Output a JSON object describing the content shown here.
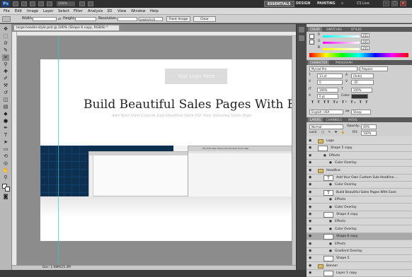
{
  "app": {
    "logo_text": "Ps",
    "zoom": "100%",
    "workspaces": [
      "ESSENTIALS",
      "DESIGN",
      "PAINTING",
      "»"
    ],
    "cs_live": "CS Live"
  },
  "menu": [
    "File",
    "Edit",
    "Image",
    "Layer",
    "Select",
    "Filter",
    "Analysis",
    "3D",
    "View",
    "Window",
    "Help"
  ],
  "options": {
    "width_label": "Width:",
    "height_label": "Height:",
    "resolution_label": "Resolution:",
    "resolution_unit": "pixels/inch",
    "front_image": "Front Image",
    "clear": "Clear"
  },
  "document": {
    "tab_title": "large-header-style.psd @ 100% (Shape 6 copy, RGB/8) *",
    "status": "Doc: 1.98M/25.3M"
  },
  "canvas": {
    "logo": "Your Logo Here",
    "headline": "Build Beautiful Sales Pages With E",
    "subheadline": "Add Your Own Custom Sub-Headline Here For Your Amazing Sales Page",
    "browser_text": "File  Edit  View  History  Bookmarks  Tools  Help"
  },
  "color_panel": {
    "tabs": [
      "COLOR",
      "SWATCHES",
      "STYLES"
    ],
    "r": "255",
    "g": "255",
    "b": "255"
  },
  "character_panel": {
    "tabs": [
      "CHARACTER",
      "PARAGRAPH"
    ],
    "font": "Myriad Pro",
    "style": "Regular",
    "size": "13 pt",
    "leading": "(Auto)",
    "kerning": "0",
    "tracking": "-25",
    "vscale": "100%",
    "hscale": "100%",
    "baseline": "0 pt",
    "color_label": "Color:",
    "language": "English: USA",
    "aa": "Sharp"
  },
  "layers_panel": {
    "tabs": [
      "LAYERS",
      "CHANNELS",
      "PATHS"
    ],
    "blend": "Normal",
    "opacity_label": "Opacity:",
    "opacity": "40%",
    "lock_label": "Lock:",
    "fill_label": "Fill:",
    "fill": "100%",
    "layers": [
      {
        "name": "Logo",
        "kind": "folder",
        "indent": 0
      },
      {
        "name": "Shape 5 copy",
        "kind": "shape",
        "indent": 0
      },
      {
        "name": "Effects",
        "kind": "fx",
        "indent": 1
      },
      {
        "name": "Color Overlay",
        "kind": "fx",
        "indent": 2
      },
      {
        "name": "Headline",
        "kind": "folder",
        "indent": 0
      },
      {
        "name": "Add Your Own Custom Sub-Headline ...",
        "kind": "text",
        "indent": 1
      },
      {
        "name": "Color Overlay",
        "kind": "fx",
        "indent": 2
      },
      {
        "name": "Build Beautiful Sales Pages With Ease",
        "kind": "text",
        "indent": 1
      },
      {
        "name": "Effects",
        "kind": "fx",
        "indent": 2
      },
      {
        "name": "Color Overlay",
        "kind": "fx",
        "indent": 2
      },
      {
        "name": "Shape 4 copy",
        "kind": "shape",
        "indent": 1
      },
      {
        "name": "Effects",
        "kind": "fx",
        "indent": 2
      },
      {
        "name": "Color Overlay",
        "kind": "fx",
        "indent": 2
      },
      {
        "name": "Shape 6 copy",
        "kind": "shape",
        "indent": 1,
        "selected": true
      },
      {
        "name": "Effects",
        "kind": "fx",
        "indent": 2
      },
      {
        "name": "Gradient Overlay",
        "kind": "fx",
        "indent": 2
      },
      {
        "name": "Shape 5",
        "kind": "shape",
        "indent": 1
      },
      {
        "name": "Banner",
        "kind": "folder",
        "indent": 0
      },
      {
        "name": "Layer 1 copy",
        "kind": "shape",
        "indent": 1
      }
    ]
  }
}
